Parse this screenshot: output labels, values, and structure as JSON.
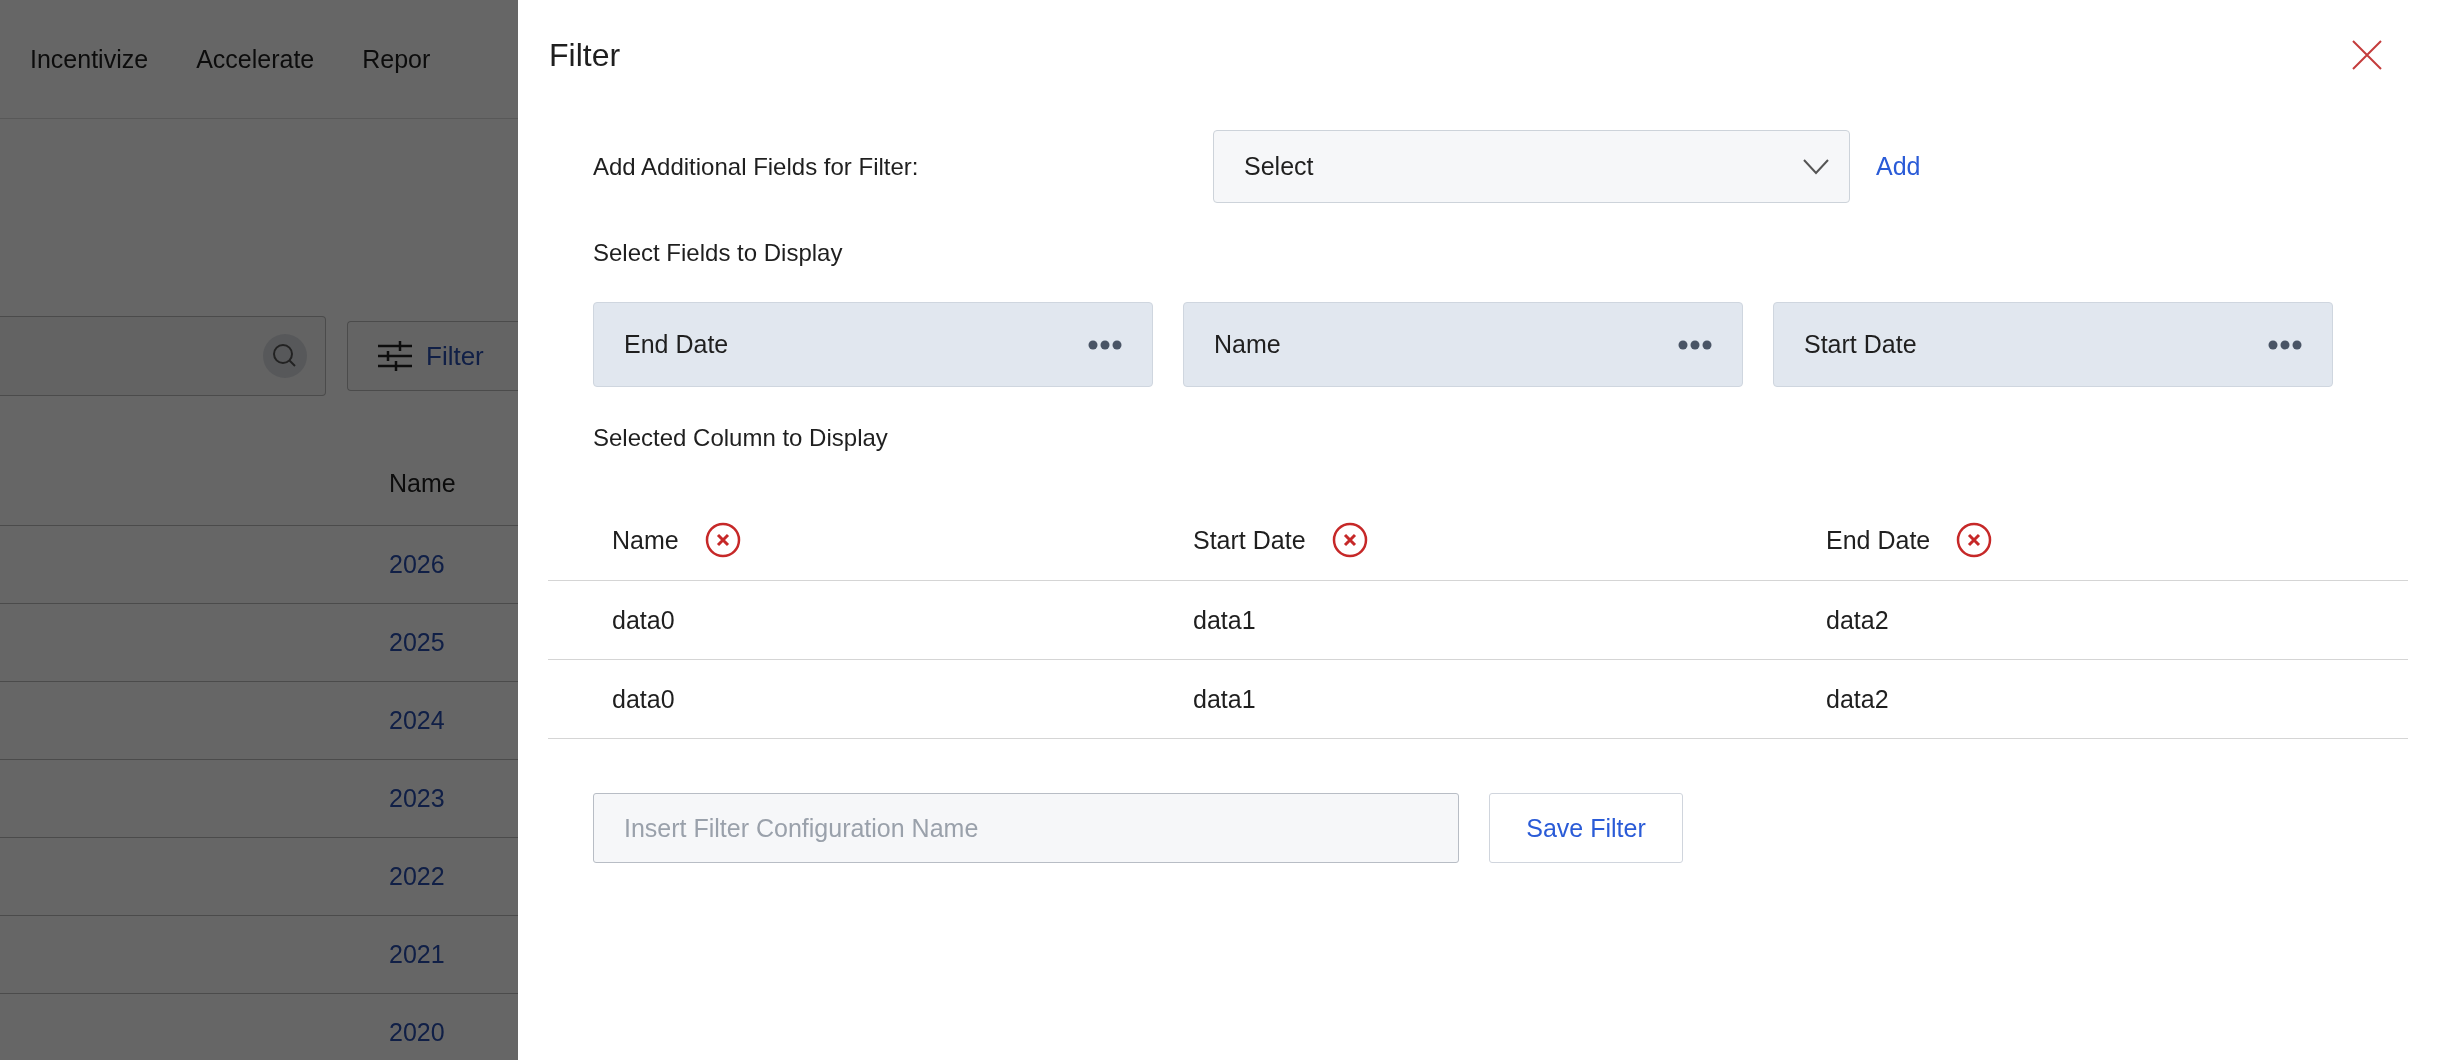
{
  "background_page": {
    "nav": [
      "Incentivize",
      "Accelerate",
      "Repor"
    ],
    "filter_button": "Filter",
    "table": {
      "column": "Name",
      "rows": [
        "2026",
        "2025",
        "2024",
        "2023",
        "2022",
        "2021",
        "2020"
      ]
    }
  },
  "dialog": {
    "title": "Filter",
    "additional_fields": {
      "label": "Add Additional Fields for Filter:",
      "select": "Select",
      "add": "Add"
    },
    "fields_heading": "Select Fields to Display",
    "fields": [
      "End Date",
      "Name",
      "Start Date"
    ],
    "selected_heading": "Selected Column to Display",
    "table": {
      "columns": [
        "Name",
        "Start Date",
        "End Date"
      ],
      "rows": [
        [
          "data0",
          "data1",
          "data2"
        ],
        [
          "data0",
          "data1",
          "data2"
        ]
      ]
    },
    "config_name": {
      "placeholder": "Insert Filter Configuration Name"
    },
    "save_button": "Save Filter"
  }
}
